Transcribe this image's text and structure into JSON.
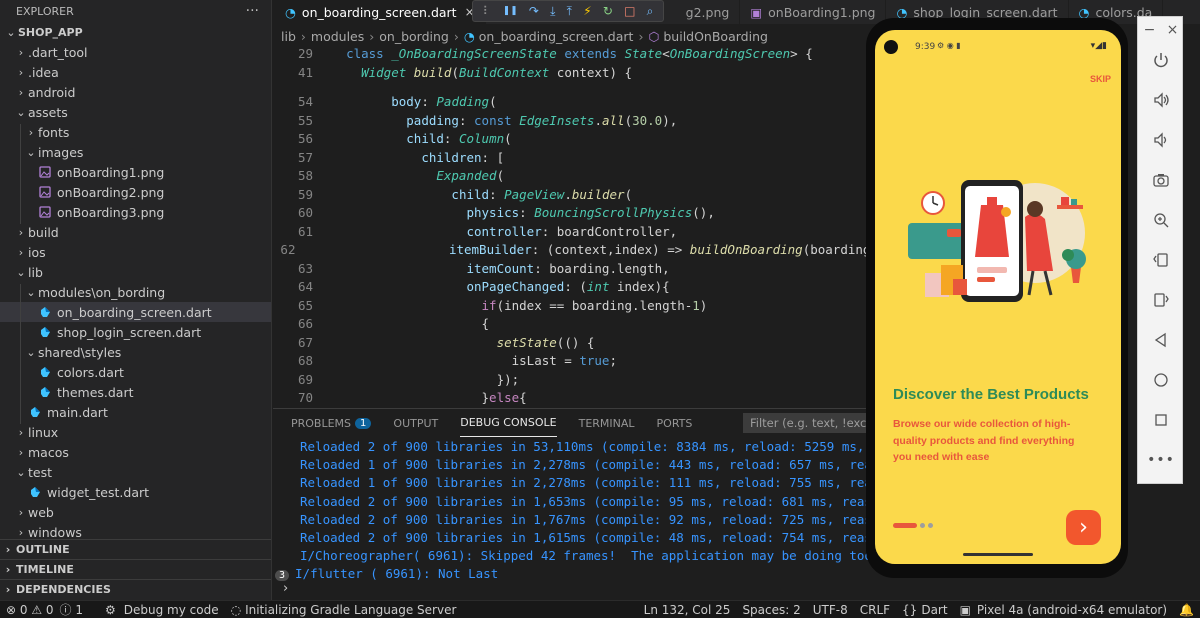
{
  "explorer": {
    "title": "EXPLORER",
    "more": "···",
    "project": "SHOP_APP",
    "items": [
      {
        "label": ".dart_tool",
        "chev": "›"
      },
      {
        "label": ".idea",
        "chev": "›"
      },
      {
        "label": "android",
        "chev": "›"
      },
      {
        "label": "assets",
        "chev": "⌄"
      },
      {
        "label": "fonts",
        "chev": "›"
      },
      {
        "label": "images",
        "chev": "⌄"
      },
      {
        "label": "onBoarding1.png"
      },
      {
        "label": "onBoarding2.png"
      },
      {
        "label": "onBoarding3.png"
      },
      {
        "label": "build",
        "chev": "›"
      },
      {
        "label": "ios",
        "chev": "›"
      },
      {
        "label": "lib",
        "chev": "⌄"
      },
      {
        "label": "modules\\on_bording",
        "chev": "⌄"
      },
      {
        "label": "on_boarding_screen.dart"
      },
      {
        "label": "shop_login_screen.dart"
      },
      {
        "label": "shared\\styles",
        "chev": "⌄"
      },
      {
        "label": "colors.dart"
      },
      {
        "label": "themes.dart"
      },
      {
        "label": "main.dart"
      },
      {
        "label": "linux",
        "chev": "›"
      },
      {
        "label": "macos",
        "chev": "›"
      },
      {
        "label": "test",
        "chev": "⌄"
      },
      {
        "label": "widget_test.dart"
      },
      {
        "label": "web",
        "chev": "›"
      },
      {
        "label": "windows",
        "chev": "›"
      }
    ],
    "sections": [
      "OUTLINE",
      "TIMELINE",
      "DEPENDENCIES"
    ]
  },
  "tabs": [
    {
      "label": "on_boarding_screen.dart",
      "close": "×"
    },
    {
      "label": "g2.png"
    },
    {
      "label": "onBoarding1.png"
    },
    {
      "label": "shop_login_screen.dart"
    },
    {
      "label": "colors.da"
    }
  ],
  "debug_toolbar": [
    "⠇",
    "❚❚",
    "↷",
    "⤓",
    "⤒",
    "⚡",
    "↻",
    "□",
    "⌕"
  ],
  "breadcrumb": [
    "lib",
    "modules",
    "on_bording",
    "on_boarding_screen.dart",
    "buildOnBoarding"
  ],
  "editor": {
    "lines": [
      {
        "n": "29",
        "code": "  class _OnBoardingScreenState extends State<OnBoardingScreen> {"
      },
      {
        "n": "41",
        "code": "    Widget build(BuildContext context) {"
      },
      {
        "n": "54",
        "code": "        body: Padding("
      },
      {
        "n": "55",
        "code": "          padding: const EdgeInsets.all(30.0),"
      },
      {
        "n": "56",
        "code": "          child: Column("
      },
      {
        "n": "57",
        "code": "            children: ["
      },
      {
        "n": "58",
        "code": "              Expanded("
      },
      {
        "n": "59",
        "code": "                child: PageView.builder("
      },
      {
        "n": "60",
        "code": "                  physics: BouncingScrollPhysics(),"
      },
      {
        "n": "61",
        "code": "                  controller: boardController,"
      },
      {
        "n": "62",
        "code": "                  itemBuilder: (context,index) => buildOnBoarding(boarding[in"
      },
      {
        "n": "63",
        "code": "                  itemCount: boarding.length,"
      },
      {
        "n": "64",
        "code": "                  onPageChanged: (int index){"
      },
      {
        "n": "65",
        "code": "                    if(index == boarding.length-1)"
      },
      {
        "n": "66",
        "code": "                    {"
      },
      {
        "n": "67",
        "code": "                      setState(() {"
      },
      {
        "n": "68",
        "code": "                        isLast = true;"
      },
      {
        "n": "69",
        "code": "                      });"
      },
      {
        "n": "70",
        "code": "                    }else{"
      },
      {
        "n": "71",
        "code": "                      setState(() {"
      }
    ]
  },
  "panel": {
    "tabs": [
      "PROBLEMS",
      "OUTPUT",
      "DEBUG CONSOLE",
      "TERMINAL",
      "PORTS"
    ],
    "problems_count": "1",
    "filter_placeholder": "Filter (e.g. text, !exclude",
    "console": [
      "Reloaded 2 of 900 libraries in 53,110ms (compile: 8384 ms, reload: 5259 ms, reas",
      "Reloaded 1 of 900 libraries in 2,278ms (compile: 443 ms, reload: 657 ms, reassem",
      "Reloaded 1 of 900 libraries in 2,278ms (compile: 111 ms, reload: 755 ms, reassem",
      "Reloaded 2 of 900 libraries in 1,653ms (compile: 95 ms, reload: 681 ms, reassemb",
      "Reloaded 2 of 900 libraries in 1,767ms (compile: 92 ms, reload: 725 ms, reassemb",
      "Reloaded 2 of 900 libraries in 1,615ms (compile: 48 ms, reload: 754 ms, reassemb",
      "I/Choreographer( 6961): Skipped 42 frames!  The application may be doing too much"
    ],
    "last_line": {
      "count": "3",
      "text": "I/flutter ( 6961): Not Last"
    },
    "prompt": "›"
  },
  "statusbar": {
    "errors": "⊗ 0 ⚠ 0",
    "info": "ⓘ 1",
    "debug": "Debug my code",
    "gradle": "Initializing Gradle Language Server",
    "position": "Ln 132, Col 25",
    "spaces": "Spaces: 2",
    "encoding": "UTF-8",
    "eol": "CRLF",
    "language": "Dart",
    "device": "Pixel 4a (android-x64 emulator)"
  },
  "phone": {
    "time": "9:39",
    "skip": "SKIP",
    "title": "Discover the Best Products",
    "body": [
      "Browse our wide collection of high-",
      "quality products and find everything",
      "you need with ease"
    ],
    "next": "›"
  },
  "emulator_window": {
    "minimize": "−",
    "close": "×"
  },
  "colors": {
    "accent": "#3794ff",
    "phone_bg": "#fbd94b",
    "phone_title": "#2e8b57",
    "phone_body": "#e8573c",
    "next_button": "#f2572d"
  }
}
